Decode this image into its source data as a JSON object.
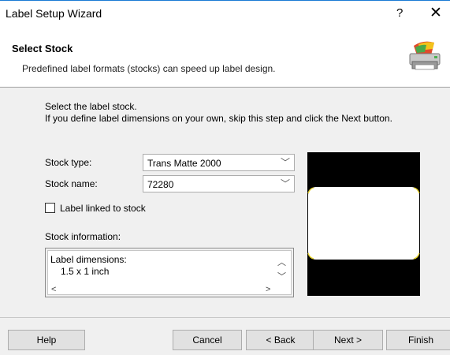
{
  "window": {
    "title": "Label Setup Wizard",
    "help_label": "?",
    "close_label": "✕"
  },
  "header": {
    "title": "Select Stock",
    "subtitle": "Predefined label formats (stocks) can speed up label design."
  },
  "intro": {
    "line1": "Select the label stock.",
    "line2": "If you define label dimensions on your own, skip this step and click the Next button."
  },
  "stock_type": {
    "label": "Stock type:",
    "value": "Trans Matte 2000"
  },
  "stock_name": {
    "label": "Stock name:",
    "value": "72280"
  },
  "linked": {
    "label": "Label linked to stock",
    "checked": false
  },
  "stock_info": {
    "label": "Stock information:",
    "line1": "Label dimensions:",
    "line2": "1.5 x 1 inch"
  },
  "buttons": {
    "help": "Help",
    "cancel": "Cancel",
    "back": "< Back",
    "next": "Next >",
    "finish": "Finish"
  },
  "colors": {
    "preview_bg": "#000000",
    "label_fill": "#ffffff",
    "label_corner": "#e6d32b",
    "title_accent": "#1a7ad4"
  }
}
